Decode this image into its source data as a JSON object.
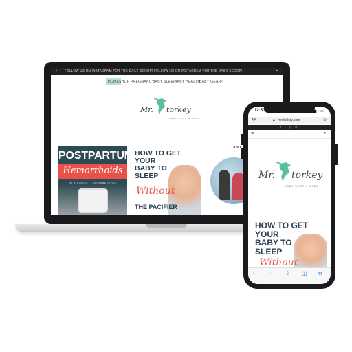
{
  "laptop": {
    "topbar_text": "FOLLOW US ON INSTAGRAM FOR THE DAILY SCOOP! FOLLOW US ON INSTAGRAM FOR THE DAILY SCOOP!",
    "nav": [
      "HOME",
      "SHOP",
      "PREGNANCY",
      "BABY SLEEP",
      "BABY HEALTH",
      "BABY GEAR"
    ],
    "logo": {
      "part1": "Mr.",
      "part2": "torkey",
      "tagline": "BABY SHOP & BLOG"
    },
    "posts": [
      {
        "title_top": "POSTPARTUM",
        "title_script": "Hemorrhoids",
        "subtitle": "MY STRUGGLE ... AND SOME ADVICE"
      },
      {
        "title": [
          "HOW TO GET YOUR",
          "BABY TO",
          "SLEEP"
        ],
        "script": "Without",
        "bottom": "THE PACIFIER"
      }
    ],
    "sidebar_heading": "ABO"
  },
  "phone": {
    "time": "12:50",
    "aa": "AA",
    "url": "mrstorkey.com",
    "logo": {
      "part1": "Mr.",
      "part2": "torkey",
      "tagline": "BABY SHOP & BLOG"
    },
    "post": {
      "title": [
        "HOW TO GET YOUR",
        "BABY TO",
        "SLEEP"
      ],
      "script": "Without"
    }
  },
  "colors": {
    "accent": "#5bbf9e",
    "nav_active": "#b8e2d7",
    "pp_bg": "#2e4a52",
    "pp_red": "#e8524a",
    "text_dark": "#2c3e50"
  }
}
